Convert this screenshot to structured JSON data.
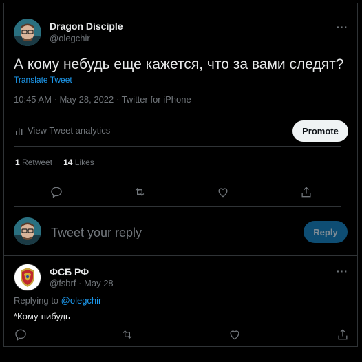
{
  "tweet": {
    "author_name": "Dragon Disciple",
    "author_handle": "@olegchir",
    "more": "···",
    "text": "А кому небудь еще кажется, что за вами следят?",
    "translate": "Translate Tweet",
    "meta": "10:45 AM · May 28, 2022 · Twitter for iPhone",
    "analytics": "View Tweet analytics",
    "promote": "Promote",
    "retweet_count": "1",
    "retweet_label": "Retweet",
    "likes_count": "14",
    "likes_label": "Likes"
  },
  "composer": {
    "placeholder": "Tweet your reply",
    "reply_button": "Reply"
  },
  "reply": {
    "author_name": "ФСБ РФ",
    "author_handle": "@fsbrf · May 28",
    "more": "···",
    "replying_prefix": "Replying to ",
    "replying_to": "@olegchir",
    "text": "*Кому-нибудь"
  },
  "icons": {
    "reply": "reply-icon",
    "retweet": "retweet-icon",
    "like": "like-icon",
    "share": "share-icon",
    "analytics": "analytics-icon"
  },
  "colors": {
    "background": "#000000",
    "accent": "#1d9bf0",
    "muted": "#71767b",
    "reply_button_bg": "#0e4d73",
    "promote_bg": "#eff3f4"
  }
}
